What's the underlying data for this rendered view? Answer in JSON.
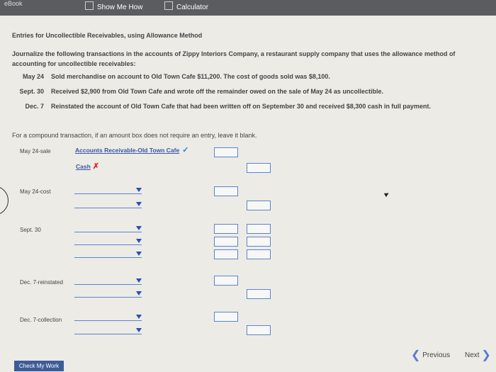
{
  "toolbar": {
    "ebook": "eBook",
    "show_me_how": "Show Me How",
    "calculator": "Calculator"
  },
  "problem": {
    "title": "Entries for Uncollectible Receivables, using Allowance Method",
    "intro": "Journalize the following transactions in the accounts of Zippy Interiors Company, a restaurant supply company that uses the allowance method of accounting for uncollectible receivables:",
    "transactions": [
      {
        "date": "May 24",
        "text": "Sold merchandise on account to Old Town Cafe $11,200. The cost of goods sold was $8,100."
      },
      {
        "date": "Sept. 30",
        "text": "Received $2,900 from Old Town Cafe and wrote off the remainder owed on the sale of May 24 as uncollectible."
      },
      {
        "date": "Dec. 7",
        "text": "Reinstated the account of Old Town Cafe that had been written off on September 30 and received $8,300 cash in full payment."
      }
    ],
    "instruction": "For a compound transaction, if an amount box does not require an entry, leave it blank."
  },
  "entries": {
    "may24_sale": {
      "label": "May 24-sale",
      "debit_account": "Accounts Receivable-Old Town Cafe",
      "credit_account": "Cash"
    },
    "may24_cost": {
      "label": "May 24-cost"
    },
    "sept30": {
      "label": "Sept. 30"
    },
    "dec7_reinstated": {
      "label": "Dec. 7-reinstated"
    },
    "dec7_collection": {
      "label": "Dec. 7-collection"
    }
  },
  "nav": {
    "previous": "Previous",
    "next": "Next",
    "check_my_work": "Check My Work"
  },
  "colors": {
    "accent": "#3d5b99",
    "link": "#3a55a5",
    "correct": "#2a7ad6",
    "incorrect": "#dd2222"
  }
}
